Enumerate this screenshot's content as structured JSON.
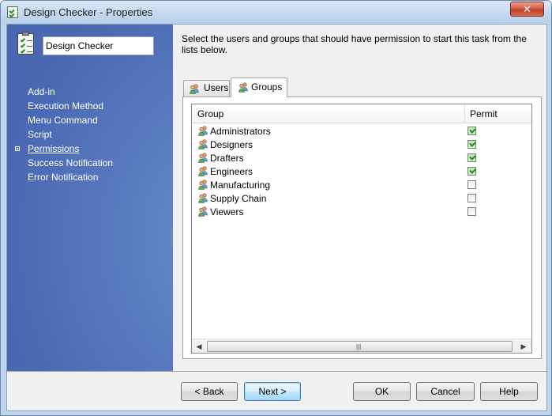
{
  "window": {
    "title": "Design Checker - Properties",
    "close_glyph": "✕"
  },
  "sidebar": {
    "task_name": "Design Checker",
    "items": [
      {
        "label": "Add-in",
        "active": false
      },
      {
        "label": "Execution Method",
        "active": false
      },
      {
        "label": "Menu Command",
        "active": false
      },
      {
        "label": "Script",
        "active": false
      },
      {
        "label": "Permissions",
        "active": true
      },
      {
        "label": "Success Notification",
        "active": false
      },
      {
        "label": "Error Notification",
        "active": false
      }
    ]
  },
  "main": {
    "instructions": "Select the users and groups that should have permission to start this task from the lists below.",
    "tabs": [
      {
        "label": "Users",
        "selected": false
      },
      {
        "label": "Groups",
        "selected": true
      }
    ],
    "table": {
      "columns": [
        "Group",
        "Permit"
      ],
      "rows": [
        {
          "group": "Administrators",
          "permit": true
        },
        {
          "group": "Designers",
          "permit": true
        },
        {
          "group": "Drafters",
          "permit": true
        },
        {
          "group": "Engineers",
          "permit": true
        },
        {
          "group": "Manufacturing",
          "permit": false
        },
        {
          "group": "Supply Chain",
          "permit": false
        },
        {
          "group": "Viewers",
          "permit": false
        }
      ]
    },
    "scrollbar": {
      "left_arrow": "◀",
      "right_arrow": "▶",
      "grip": "|||"
    }
  },
  "buttons": {
    "back": "< Back",
    "next": "Next >",
    "ok": "OK",
    "cancel": "Cancel",
    "help": "Help"
  },
  "icons": {
    "title": "checklist-icon",
    "task": "clipboard-checklist-icon",
    "group": "users-group-icon"
  },
  "colors": {
    "sidebar_blue": "#5a7cc1",
    "check_green": "#1f8a1f",
    "close_red": "#c23b21"
  }
}
